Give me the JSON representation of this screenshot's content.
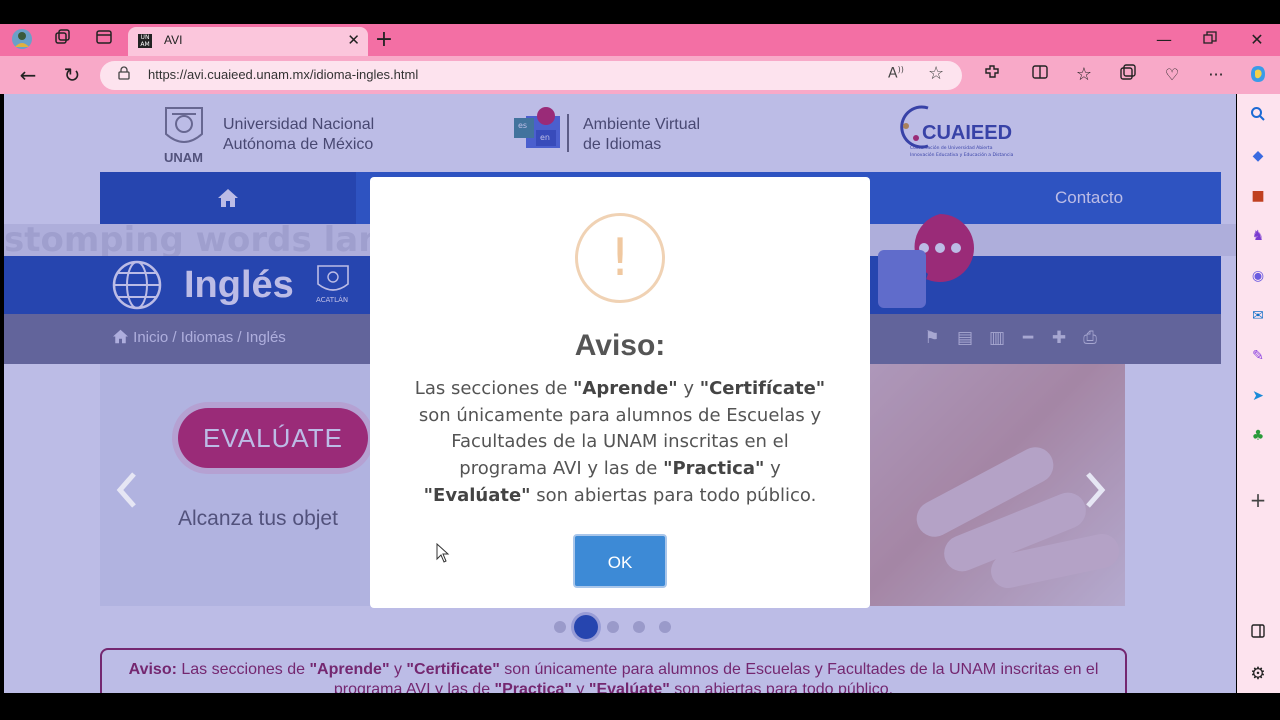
{
  "browser": {
    "tab_title": "AVI",
    "tab_favicon_text": "UN AM",
    "url": "https://avi.cuaieed.unam.mx/idioma-ingles.html"
  },
  "header": {
    "unam_line1": "Universidad Nacional",
    "unam_line2": "Autónoma de México",
    "unam_short": "UNAM",
    "avi_line1": "Ambiente Virtual",
    "avi_line2": "de Idiomas",
    "avi_logo_es": "es",
    "avi_logo_en": "en",
    "cuaieed_name": "CUAIEED",
    "cuaieed_sub1": "Coordinación de Universidad Abierta",
    "cuaieed_sub2": "Innovación Educativa y Educación a Distancia"
  },
  "nav": {
    "contact_label": "Contacto"
  },
  "banner": {
    "background_words": "stomping   words   language   learn   speak   talk",
    "title": "Inglés",
    "fes_label": "ACATLÁN"
  },
  "breadcrumb": {
    "items": [
      "Inicio",
      "Idiomas",
      "Inglés"
    ],
    "separator": "/"
  },
  "slider": {
    "button_label": "EVALÚATE",
    "caption": "Alcanza tus objet",
    "active_slide": 2,
    "total_slides": 5
  },
  "notice": {
    "prefix": "Aviso:",
    "t1": " Las secciones de ",
    "b1": "\"Aprende\"",
    "t2": " y ",
    "b2": "\"Certificate\"",
    "t3": " son únicamente para alumnos de Escuelas y Facultades de la UNAM inscritas en el programa AVI y las de ",
    "b3": "\"Practica\"",
    "t4": " y ",
    "b4": "\"Evalúate\"",
    "t5": " son abiertas para todo público."
  },
  "modal": {
    "icon_glyph": "!",
    "title": "Aviso:",
    "t1": "Las secciones de ",
    "b1": "\"Aprende\"",
    "t2": " y ",
    "b2": "\"Certifícate\"",
    "t3": " son únicamente para alumnos de Escuelas y Facultades de la UNAM inscritas en el programa AVI y las de ",
    "b3": "\"Practica\"",
    "t4": " y ",
    "b4": "\"Evalúate\"",
    "t5": " son abiertas para todo público.",
    "ok_label": "OK"
  },
  "colors": {
    "tabstrip": "#f36fa4",
    "toolbar": "#f8a9c8",
    "nav_blue": "#1a56c4",
    "dark_blue": "#0d3fa6",
    "accent_red": "#c8154e",
    "notice_maroon": "#8c1042",
    "ok_button": "#3d8ad6"
  }
}
